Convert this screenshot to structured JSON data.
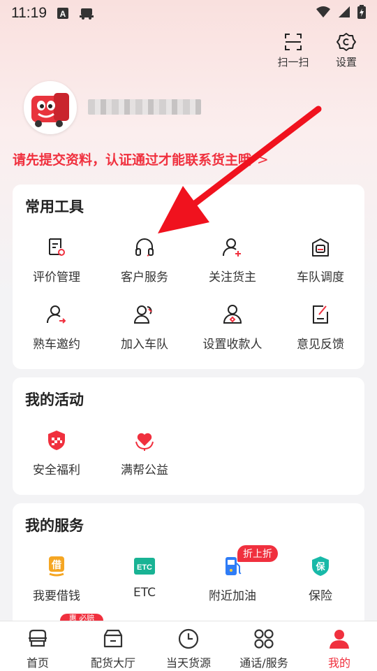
{
  "status_bar": {
    "time": "11:19"
  },
  "top_actions": [
    {
      "label": "扫一扫",
      "icon": "scan-icon"
    },
    {
      "label": "设置",
      "icon": "settings-icon"
    }
  ],
  "profile": {
    "notice": "请先提交资料，认证通过才能联系货主哦",
    "notice_chevron": ">"
  },
  "common_tools": {
    "title": "常用工具",
    "items": [
      {
        "label": "评价管理",
        "icon": "review-icon"
      },
      {
        "label": "客户服务",
        "icon": "headset-icon"
      },
      {
        "label": "关注货主",
        "icon": "follow-user-icon"
      },
      {
        "label": "车队调度",
        "icon": "fleet-dispatch-icon"
      },
      {
        "label": "熟车邀约",
        "icon": "invite-user-icon"
      },
      {
        "label": "加入车队",
        "icon": "join-team-icon"
      },
      {
        "label": "设置收款人",
        "icon": "payee-icon"
      },
      {
        "label": "意见反馈",
        "icon": "feedback-icon"
      }
    ]
  },
  "activities": {
    "title": "我的活动",
    "items": [
      {
        "label": "安全福利",
        "icon": "safety-shield-icon"
      },
      {
        "label": "满帮公益",
        "icon": "charity-heart-icon"
      }
    ]
  },
  "services": {
    "title": "我的服务",
    "items": [
      {
        "label": "我要借钱",
        "icon": "borrow-money-icon"
      },
      {
        "label": "ETC",
        "icon": "etc-icon",
        "icon_text": "ETC"
      },
      {
        "label": "附近加油",
        "icon": "fuel-icon",
        "badge": "折上折"
      },
      {
        "label": "保险",
        "icon": "insurance-icon",
        "icon_text": "保"
      }
    ],
    "peek_badge": "惠 必赔"
  },
  "tabbar": [
    {
      "label": "首页",
      "icon": "home-icon"
    },
    {
      "label": "配货大厅",
      "icon": "cargo-hall-icon"
    },
    {
      "label": "当天货源",
      "icon": "clock-icon"
    },
    {
      "label": "通话/服务",
      "icon": "services-grid-icon"
    },
    {
      "label": "我的",
      "icon": "profile-icon",
      "active": true
    }
  ],
  "colors": {
    "accent": "#f0303e",
    "etc": "#19b394",
    "insurance": "#18b9a8",
    "fuel": "#2f7cf6",
    "borrow": "#f5a623"
  }
}
